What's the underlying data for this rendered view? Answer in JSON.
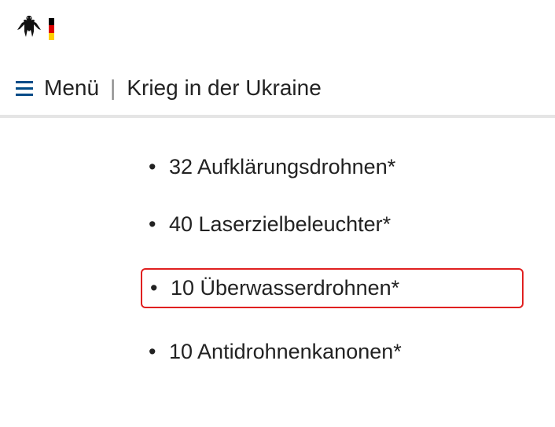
{
  "header": {
    "menu_label": "Menü",
    "separator": "|",
    "breadcrumb_current": "Krieg in der Ukraine"
  },
  "content": {
    "items": [
      {
        "text": "32 Aufklärungsdrohnen*",
        "highlighted": false
      },
      {
        "text": "40 Laserzielbeleuchter*",
        "highlighted": false
      },
      {
        "text": "10 Überwasserdrohnen*",
        "highlighted": true
      },
      {
        "text": "10 Antidrohnenkanonen*",
        "highlighted": false
      }
    ]
  }
}
